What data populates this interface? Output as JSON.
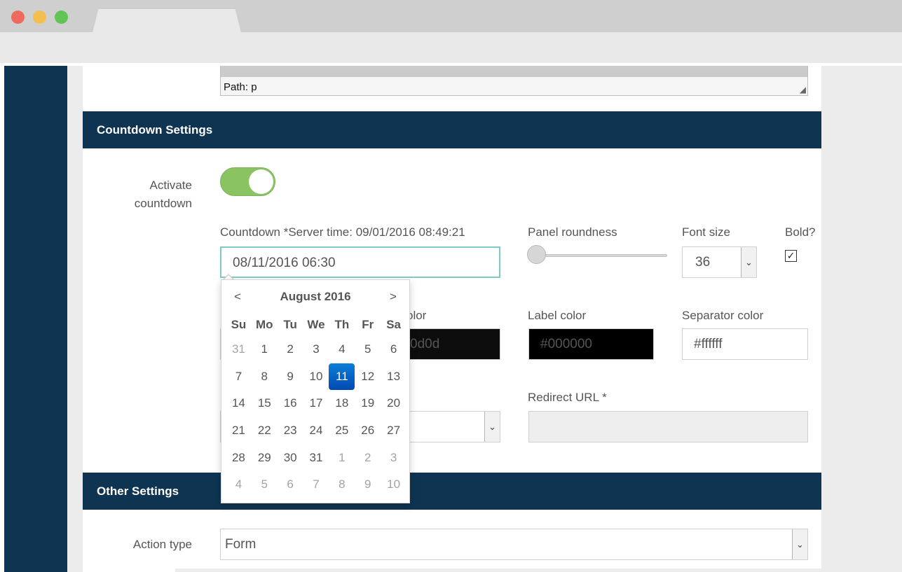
{
  "editor": {
    "path": "Path: p"
  },
  "countdown_section": {
    "title": "Countdown Settings",
    "activate_label": "Activate countdown",
    "countdown_label": "Countdown *Server time: 09/01/2016 08:49:21",
    "countdown_value": "08/11/2016 06:30",
    "panel_roundness_label": "Panel roundness",
    "panel_roundness_value": 0,
    "font_size_label": "Font size",
    "font_size_value": "36",
    "bold_label": "Bold?",
    "bold_checked": true,
    "color_label_partial": "olor",
    "color_value_partial": "0d0d",
    "label_color_label": "Label color",
    "label_color_value": "#000000",
    "separator_color_label": "Separator color",
    "separator_color_value": "#ffffff",
    "redirect_url_label": "Redirect URL *",
    "redirect_url_value": ""
  },
  "other_section": {
    "title": "Other Settings",
    "action_type_label": "Action type",
    "action_type_value": "Form"
  },
  "datepicker": {
    "prev": "<",
    "next": ">",
    "title": "August 2016",
    "weekdays": [
      "Su",
      "Mo",
      "Tu",
      "We",
      "Th",
      "Fr",
      "Sa"
    ],
    "weeks": [
      [
        {
          "d": "31",
          "m": true
        },
        {
          "d": "1"
        },
        {
          "d": "2"
        },
        {
          "d": "3"
        },
        {
          "d": "4"
        },
        {
          "d": "5"
        },
        {
          "d": "6"
        }
      ],
      [
        {
          "d": "7"
        },
        {
          "d": "8"
        },
        {
          "d": "9"
        },
        {
          "d": "10"
        },
        {
          "d": "11",
          "a": true
        },
        {
          "d": "12"
        },
        {
          "d": "13"
        }
      ],
      [
        {
          "d": "14"
        },
        {
          "d": "15"
        },
        {
          "d": "16"
        },
        {
          "d": "17"
        },
        {
          "d": "18"
        },
        {
          "d": "19"
        },
        {
          "d": "20"
        }
      ],
      [
        {
          "d": "21"
        },
        {
          "d": "22"
        },
        {
          "d": "23"
        },
        {
          "d": "24"
        },
        {
          "d": "25"
        },
        {
          "d": "26"
        },
        {
          "d": "27"
        }
      ],
      [
        {
          "d": "28"
        },
        {
          "d": "29"
        },
        {
          "d": "30"
        },
        {
          "d": "31"
        },
        {
          "d": "1",
          "m": true
        },
        {
          "d": "2",
          "m": true
        },
        {
          "d": "3",
          "m": true
        }
      ],
      [
        {
          "d": "4",
          "m": true
        },
        {
          "d": "5",
          "m": true
        },
        {
          "d": "6",
          "m": true
        },
        {
          "d": "7",
          "m": true
        },
        {
          "d": "8",
          "m": true
        },
        {
          "d": "9",
          "m": true
        },
        {
          "d": "10",
          "m": true
        }
      ]
    ]
  },
  "colors": {
    "header_bg": "#0e3452",
    "toggle_on": "#8ac462",
    "focus_border": "#7fcbc4",
    "selected_day": "#0d6fd0"
  }
}
